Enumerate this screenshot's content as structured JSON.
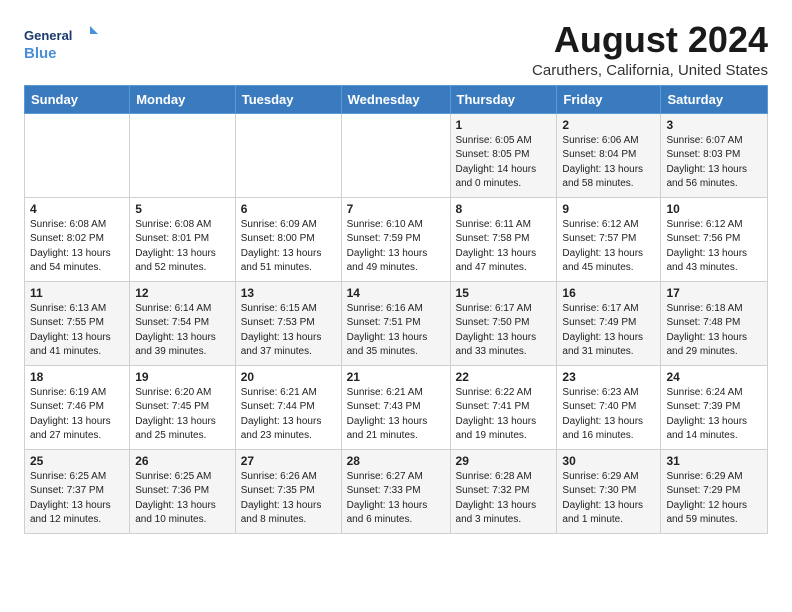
{
  "logo": {
    "text_general": "General",
    "text_blue": "Blue"
  },
  "title": "August 2024",
  "subtitle": "Caruthers, California, United States",
  "days_header": [
    "Sunday",
    "Monday",
    "Tuesday",
    "Wednesday",
    "Thursday",
    "Friday",
    "Saturday"
  ],
  "weeks": [
    [
      {
        "day": "",
        "sunrise": "",
        "sunset": "",
        "daylight": ""
      },
      {
        "day": "",
        "sunrise": "",
        "sunset": "",
        "daylight": ""
      },
      {
        "day": "",
        "sunrise": "",
        "sunset": "",
        "daylight": ""
      },
      {
        "day": "",
        "sunrise": "",
        "sunset": "",
        "daylight": ""
      },
      {
        "day": "1",
        "sunrise": "Sunrise: 6:05 AM",
        "sunset": "Sunset: 8:05 PM",
        "daylight": "Daylight: 14 hours and 0 minutes."
      },
      {
        "day": "2",
        "sunrise": "Sunrise: 6:06 AM",
        "sunset": "Sunset: 8:04 PM",
        "daylight": "Daylight: 13 hours and 58 minutes."
      },
      {
        "day": "3",
        "sunrise": "Sunrise: 6:07 AM",
        "sunset": "Sunset: 8:03 PM",
        "daylight": "Daylight: 13 hours and 56 minutes."
      }
    ],
    [
      {
        "day": "4",
        "sunrise": "Sunrise: 6:08 AM",
        "sunset": "Sunset: 8:02 PM",
        "daylight": "Daylight: 13 hours and 54 minutes."
      },
      {
        "day": "5",
        "sunrise": "Sunrise: 6:08 AM",
        "sunset": "Sunset: 8:01 PM",
        "daylight": "Daylight: 13 hours and 52 minutes."
      },
      {
        "day": "6",
        "sunrise": "Sunrise: 6:09 AM",
        "sunset": "Sunset: 8:00 PM",
        "daylight": "Daylight: 13 hours and 51 minutes."
      },
      {
        "day": "7",
        "sunrise": "Sunrise: 6:10 AM",
        "sunset": "Sunset: 7:59 PM",
        "daylight": "Daylight: 13 hours and 49 minutes."
      },
      {
        "day": "8",
        "sunrise": "Sunrise: 6:11 AM",
        "sunset": "Sunset: 7:58 PM",
        "daylight": "Daylight: 13 hours and 47 minutes."
      },
      {
        "day": "9",
        "sunrise": "Sunrise: 6:12 AM",
        "sunset": "Sunset: 7:57 PM",
        "daylight": "Daylight: 13 hours and 45 minutes."
      },
      {
        "day": "10",
        "sunrise": "Sunrise: 6:12 AM",
        "sunset": "Sunset: 7:56 PM",
        "daylight": "Daylight: 13 hours and 43 minutes."
      }
    ],
    [
      {
        "day": "11",
        "sunrise": "Sunrise: 6:13 AM",
        "sunset": "Sunset: 7:55 PM",
        "daylight": "Daylight: 13 hours and 41 minutes."
      },
      {
        "day": "12",
        "sunrise": "Sunrise: 6:14 AM",
        "sunset": "Sunset: 7:54 PM",
        "daylight": "Daylight: 13 hours and 39 minutes."
      },
      {
        "day": "13",
        "sunrise": "Sunrise: 6:15 AM",
        "sunset": "Sunset: 7:53 PM",
        "daylight": "Daylight: 13 hours and 37 minutes."
      },
      {
        "day": "14",
        "sunrise": "Sunrise: 6:16 AM",
        "sunset": "Sunset: 7:51 PM",
        "daylight": "Daylight: 13 hours and 35 minutes."
      },
      {
        "day": "15",
        "sunrise": "Sunrise: 6:17 AM",
        "sunset": "Sunset: 7:50 PM",
        "daylight": "Daylight: 13 hours and 33 minutes."
      },
      {
        "day": "16",
        "sunrise": "Sunrise: 6:17 AM",
        "sunset": "Sunset: 7:49 PM",
        "daylight": "Daylight: 13 hours and 31 minutes."
      },
      {
        "day": "17",
        "sunrise": "Sunrise: 6:18 AM",
        "sunset": "Sunset: 7:48 PM",
        "daylight": "Daylight: 13 hours and 29 minutes."
      }
    ],
    [
      {
        "day": "18",
        "sunrise": "Sunrise: 6:19 AM",
        "sunset": "Sunset: 7:46 PM",
        "daylight": "Daylight: 13 hours and 27 minutes."
      },
      {
        "day": "19",
        "sunrise": "Sunrise: 6:20 AM",
        "sunset": "Sunset: 7:45 PM",
        "daylight": "Daylight: 13 hours and 25 minutes."
      },
      {
        "day": "20",
        "sunrise": "Sunrise: 6:21 AM",
        "sunset": "Sunset: 7:44 PM",
        "daylight": "Daylight: 13 hours and 23 minutes."
      },
      {
        "day": "21",
        "sunrise": "Sunrise: 6:21 AM",
        "sunset": "Sunset: 7:43 PM",
        "daylight": "Daylight: 13 hours and 21 minutes."
      },
      {
        "day": "22",
        "sunrise": "Sunrise: 6:22 AM",
        "sunset": "Sunset: 7:41 PM",
        "daylight": "Daylight: 13 hours and 19 minutes."
      },
      {
        "day": "23",
        "sunrise": "Sunrise: 6:23 AM",
        "sunset": "Sunset: 7:40 PM",
        "daylight": "Daylight: 13 hours and 16 minutes."
      },
      {
        "day": "24",
        "sunrise": "Sunrise: 6:24 AM",
        "sunset": "Sunset: 7:39 PM",
        "daylight": "Daylight: 13 hours and 14 minutes."
      }
    ],
    [
      {
        "day": "25",
        "sunrise": "Sunrise: 6:25 AM",
        "sunset": "Sunset: 7:37 PM",
        "daylight": "Daylight: 13 hours and 12 minutes."
      },
      {
        "day": "26",
        "sunrise": "Sunrise: 6:25 AM",
        "sunset": "Sunset: 7:36 PM",
        "daylight": "Daylight: 13 hours and 10 minutes."
      },
      {
        "day": "27",
        "sunrise": "Sunrise: 6:26 AM",
        "sunset": "Sunset: 7:35 PM",
        "daylight": "Daylight: 13 hours and 8 minutes."
      },
      {
        "day": "28",
        "sunrise": "Sunrise: 6:27 AM",
        "sunset": "Sunset: 7:33 PM",
        "daylight": "Daylight: 13 hours and 6 minutes."
      },
      {
        "day": "29",
        "sunrise": "Sunrise: 6:28 AM",
        "sunset": "Sunset: 7:32 PM",
        "daylight": "Daylight: 13 hours and 3 minutes."
      },
      {
        "day": "30",
        "sunrise": "Sunrise: 6:29 AM",
        "sunset": "Sunset: 7:30 PM",
        "daylight": "Daylight: 13 hours and 1 minute."
      },
      {
        "day": "31",
        "sunrise": "Sunrise: 6:29 AM",
        "sunset": "Sunset: 7:29 PM",
        "daylight": "Daylight: 12 hours and 59 minutes."
      }
    ]
  ]
}
